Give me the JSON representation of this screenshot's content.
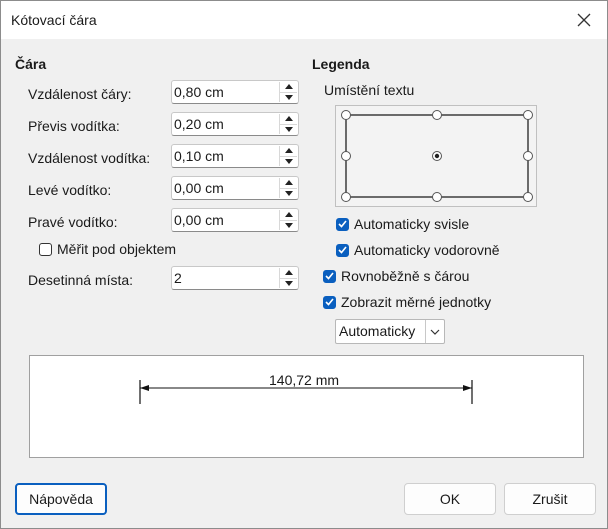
{
  "window": {
    "title": "Kótovací čára"
  },
  "line": {
    "title": "Čára",
    "fields": [
      {
        "label": "Vzdálenost čáry:",
        "value": "0,80 cm"
      },
      {
        "label": "Převis vodítka:",
        "value": "0,20 cm"
      },
      {
        "label": "Vzdálenost vodítka:",
        "value": "0,10 cm"
      },
      {
        "label": "Levé vodítko:",
        "value": "0,00 cm"
      },
      {
        "label": "Pravé vodítko:",
        "value": "0,00 cm"
      }
    ],
    "measure_below": {
      "label": "Měřit pod objektem",
      "checked": false
    },
    "decimals": {
      "label": "Desetinná místa:",
      "value": "2"
    }
  },
  "legend": {
    "title": "Legenda",
    "text_position_label": "Umístění textu",
    "auto_vertical": {
      "label": "Automaticky svisle",
      "checked": true
    },
    "auto_horizontal": {
      "label": "Automaticky vodorovně",
      "checked": true
    },
    "parallel": {
      "label": "Rovnoběžně s čárou",
      "checked": true
    },
    "show_units": {
      "label": "Zobrazit měrné jednotky",
      "checked": true
    },
    "units_select": {
      "value": "Automaticky"
    }
  },
  "preview": {
    "measurement": "140,72 mm"
  },
  "buttons": {
    "help": "Nápověda",
    "ok": "OK",
    "cancel": "Zrušit"
  },
  "colors": {
    "accent": "#0a5fbf",
    "background": "#f0f0f0"
  }
}
